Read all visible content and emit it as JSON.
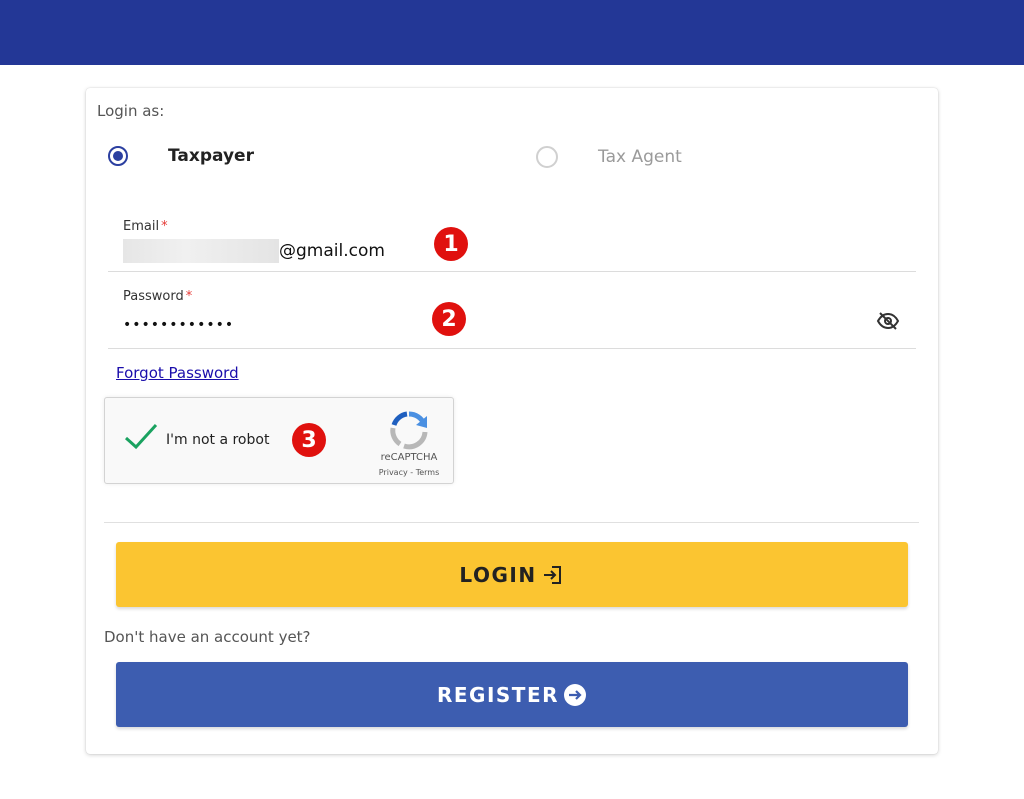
{
  "login_as": {
    "label": "Login as:",
    "options": [
      {
        "label": "Taxpayer",
        "checked": true
      },
      {
        "label": "Tax Agent",
        "checked": false
      }
    ]
  },
  "email": {
    "label": "Email",
    "required_mark": "*",
    "value_suffix": "@gmail.com"
  },
  "password": {
    "label": "Password",
    "required_mark": "*",
    "value": "••••••••••••",
    "icon": "eye-off-icon"
  },
  "badges": [
    "1",
    "2",
    "3"
  ],
  "forgot_password": "Forgot Password",
  "recaptcha": {
    "text": "I'm not a robot",
    "brand": "reCAPTCHA",
    "links": "Privacy - Terms"
  },
  "login_button": "LOGIN",
  "no_account_text": "Don't have an account yet?",
  "register_button": "REGISTER",
  "colors": {
    "topbar": "#233796",
    "login_button": "#fbc531",
    "register_button": "#3d5db0",
    "badge": "#e0110e",
    "radio_checked": "#2b3fa0"
  }
}
